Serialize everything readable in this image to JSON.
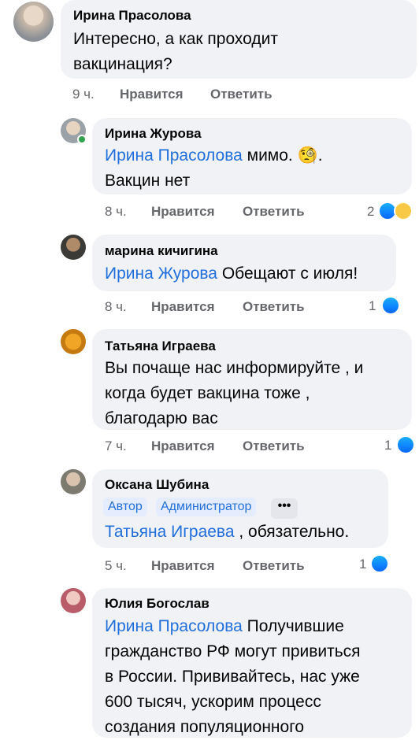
{
  "comments": [
    {
      "author": "Ирина Прасолова",
      "text_lines": [
        "Интересно, а как проходит",
        "вакцинация?"
      ],
      "time": "9 ч.",
      "like_label": "Нравится",
      "reply_label": "Ответить"
    },
    {
      "author": "Ирина Журова",
      "mention": "Ирина Прасолова",
      "text_after": " мимо. 🧐.",
      "text_line2": "Вакцин нет",
      "time": "8 ч.",
      "like_label": "Нравится",
      "reply_label": "Ответить",
      "reactions": "2"
    },
    {
      "author": "марина кичигина",
      "mention": "Ирина Журова",
      "text_after": " Обещают с июля!",
      "time": "8 ч.",
      "like_label": "Нравится",
      "reply_label": "Ответить",
      "reactions": "1"
    },
    {
      "author": "Татьяна Играева",
      "text_lines": [
        "Вы почаще нас информируйте , и",
        "когда будет вакцина тоже ,",
        "благодарю вас"
      ],
      "time": "7 ч.",
      "like_label": "Нравится",
      "reply_label": "Ответить",
      "reactions": "1"
    },
    {
      "author": "Оксана Шубина",
      "badge_author": "Автор",
      "badge_admin": "Администратор",
      "mention": "Татьяна Играева",
      "text_after": " , обязательно.",
      "time": "5 ч.",
      "like_label": "Нравится",
      "reply_label": "Ответить",
      "reactions": "1"
    },
    {
      "author": "Юлия Богослав",
      "mention": "Ирина Прасолова",
      "text_after": " Получившие",
      "text_lines": [
        "гражданство РФ могут привиться",
        "в России. Прививайтесь, нас уже",
        "600 тысяч, ускорим процесс",
        "создания популяционного"
      ]
    }
  ],
  "more_label": "•••"
}
